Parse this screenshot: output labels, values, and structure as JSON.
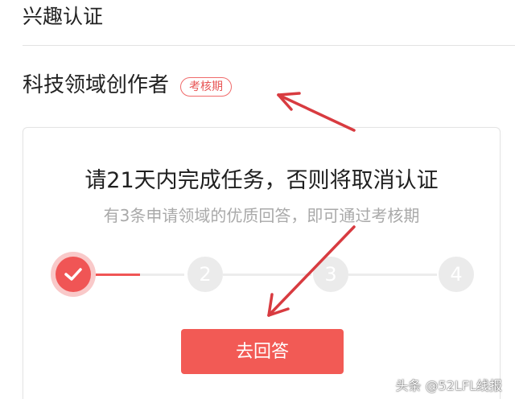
{
  "header": {
    "section_title": "兴趣认证"
  },
  "creator": {
    "title": "科技领域创作者",
    "status_badge": "考核期"
  },
  "task_card": {
    "title": "请21天内完成任务，否则将取消认证",
    "subtitle": "有3条申请领域的优质回答，即可通过考核期",
    "steps": [
      {
        "label": "",
        "state": "done"
      },
      {
        "label": "2",
        "state": "pending"
      },
      {
        "label": "3",
        "state": "pending"
      },
      {
        "label": "4",
        "state": "pending"
      }
    ],
    "first_segment_progress": 0.5,
    "action_button_label": "去回答"
  },
  "watermark": "头条 @52LFL线报",
  "colors": {
    "accent": "#f25a55",
    "accent_light": "#f9c9c9",
    "step_inactive": "#ebebeb",
    "arrow": "#d83b40"
  },
  "icons": {
    "step_done": "checkmark-icon"
  }
}
